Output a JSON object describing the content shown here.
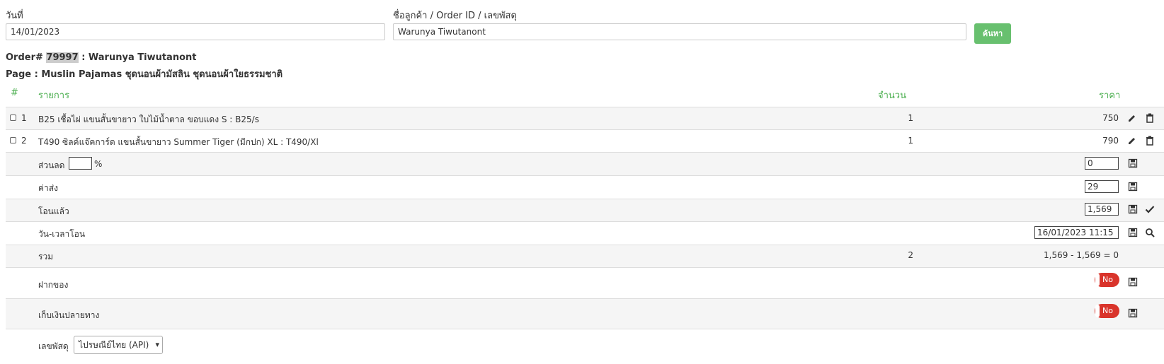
{
  "search": {
    "date_label": "วันที่",
    "date_value": "14/01/2023",
    "customer_label": "ชื่อลูกค้า / Order ID / เลขพัสดุ",
    "customer_value": "Warunya Tiwutanont",
    "search_button": "ค้นหา"
  },
  "order": {
    "order_prefix": "Order#",
    "order_id": "79997",
    "customer_suffix": ": Warunya Tiwutanont",
    "page_line": "Page : Muslin Pajamas ชุดนอนผ้ามัสลิน ชุดนอนผ้าใยธรรมชาติ"
  },
  "table": {
    "headers": {
      "num": "#",
      "item": "รายการ",
      "qty": "จำนวน",
      "price": "ราคา"
    },
    "items": [
      {
        "no": "1",
        "name": "B25 เชื้อไผ่ แขนสั้นขายาว ใบไม้น้ำตาล ขอบแดง S : B25/s",
        "qty": "1",
        "price": "750"
      },
      {
        "no": "2",
        "name": "T490 ซิลค์แจ๊คการ์ด แขนสั้นขายาว Summer Tiger (มีกปก) XL : T490/Xl",
        "qty": "1",
        "price": "790"
      }
    ],
    "discount": {
      "label": "ส่วนลด",
      "pct_value": "",
      "pct_symbol": "%",
      "value": "0"
    },
    "shipping": {
      "label": "ค่าส่ง",
      "value": "29"
    },
    "transferred": {
      "label": "โอนแล้ว",
      "value": "1,569"
    },
    "transfer_time": {
      "label": "วัน-เวลาโอน",
      "value": "16/01/2023 11:15"
    },
    "total": {
      "label": "รวม",
      "qty": "2",
      "formula": "1,569 - 1,569 = 0"
    },
    "deposit": {
      "label": "ฝากของ",
      "toggle": "No"
    },
    "cod": {
      "label": "เก็บเงินปลายทาง",
      "toggle": "No"
    },
    "tracking": {
      "label": "เลขพัสดุ",
      "carrier": "ไปรษณีย์ไทย (API)"
    }
  },
  "colors": {
    "accent_green": "#68c06f",
    "header_green": "#4caf50",
    "toggle_red": "#d9342b"
  },
  "icons": [
    "pencil-icon",
    "trash-icon",
    "save-icon",
    "check-icon",
    "search-icon",
    "chevron-down-icon"
  ]
}
